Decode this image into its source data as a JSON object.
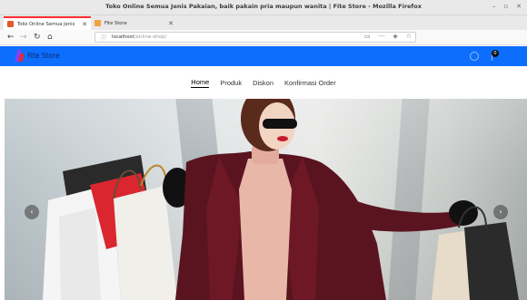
{
  "window": {
    "title": "Toko Online Semua Jenis Pakaian, baik pakain pria maupun wanita | Fite Store - Mozilla Firefox"
  },
  "tabs": [
    {
      "label": "Toko Online Semua Jenis Pa...",
      "active": true,
      "favicon_color": "#e15a2c"
    },
    {
      "label": "Fite Store",
      "active": false,
      "favicon_color": "#f2a33a"
    }
  ],
  "urlbar": {
    "host": "localhost",
    "path": "/online-shop/"
  },
  "site": {
    "name": "Fite Store",
    "header_color": "#0d6efd",
    "cart_count": "0",
    "nav": [
      {
        "label": "Home",
        "active": true
      },
      {
        "label": "Produk",
        "active": false
      },
      {
        "label": "Diskon",
        "active": false
      },
      {
        "label": "Konfirmasi Order",
        "active": false
      }
    ]
  },
  "carousel": {
    "prev_icon": "chevron-left-icon",
    "next_icon": "chevron-right-icon"
  }
}
